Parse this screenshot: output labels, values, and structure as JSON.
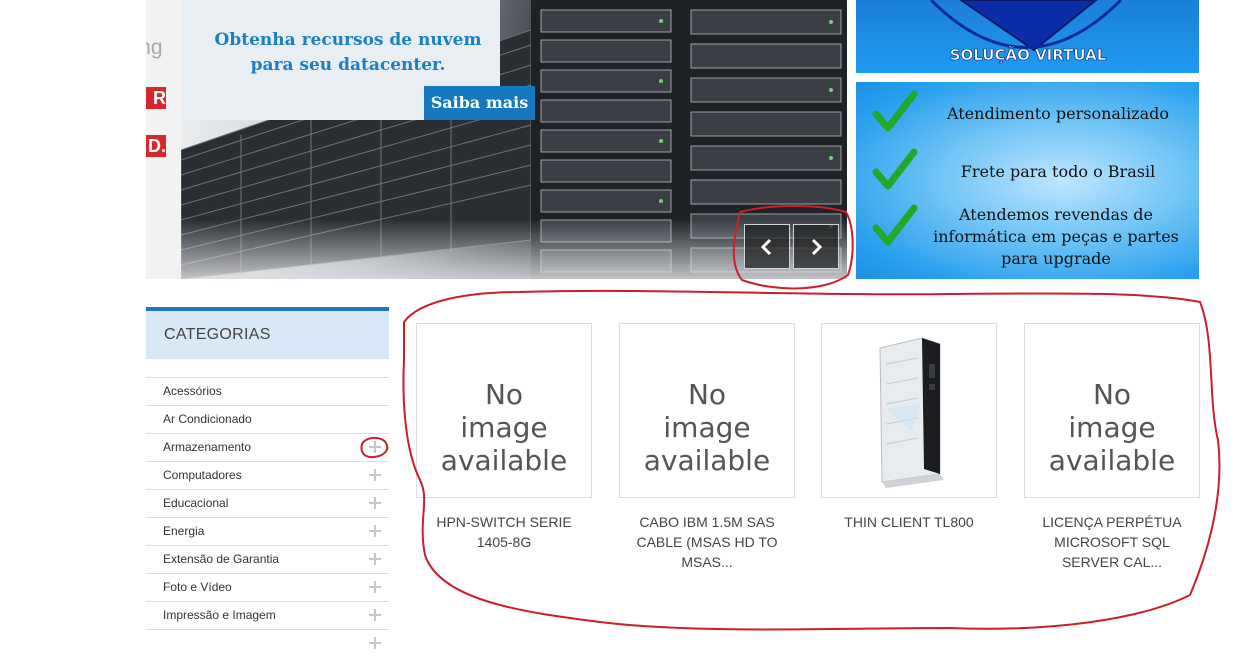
{
  "slider": {
    "strip_text": "king",
    "strip_badge_1": "R",
    "strip_badge_2": "D.",
    "promo_line1": "Obtenha recursos de nuvem",
    "promo_line2": "para seu datacenter.",
    "promo_button": "Saiba mais",
    "prev_icon": "chevron-left-icon",
    "next_icon": "chevron-right-icon"
  },
  "logo_banner": {
    "logo_text": "SOLUÇÃO VIRTUAL"
  },
  "features": [
    {
      "icon": "check-icon",
      "text": "Atendimento personalizado"
    },
    {
      "icon": "check-icon",
      "text": "Frete para todo o Brasil"
    },
    {
      "icon": "check-icon",
      "text": "Atendemos revendas de informática em peças e partes para upgrade"
    }
  ],
  "categories": {
    "title": "CATEGORIAS",
    "items": [
      {
        "label": "Acessórios",
        "expandable": false
      },
      {
        "label": "Ar Condicionado",
        "expandable": false
      },
      {
        "label": "Armazenamento",
        "expandable": true
      },
      {
        "label": "Computadores",
        "expandable": true
      },
      {
        "label": "Educacional",
        "expandable": true
      },
      {
        "label": "Energia",
        "expandable": true
      },
      {
        "label": "Extensão de Garantia",
        "expandable": true
      },
      {
        "label": "Foto e Vídeo",
        "expandable": true
      },
      {
        "label": "Impressão e Imagem",
        "expandable": true
      },
      {
        "label": "",
        "expandable": true
      }
    ]
  },
  "products": [
    {
      "image_text": "No image available",
      "name": "HPN-SWITCH SERIE 1405-8G",
      "has_image": false
    },
    {
      "image_text": "No image available",
      "name": "CABO IBM 1.5M SAS CABLE (MSAS HD TO MSAS...",
      "has_image": false
    },
    {
      "image_text": "",
      "name": "THIN CLIENT TL800",
      "has_image": true
    },
    {
      "image_text": "No image available",
      "name": "LICENÇA PERPÉTUA MICROSOFT SQL SERVER CAL...",
      "has_image": false
    }
  ],
  "colors": {
    "accent_blue": "#1d77c2",
    "category_header_bg": "#d9e8f6",
    "annotation_red": "#cc1f2a",
    "promo_blue": "#1b7fc4"
  }
}
